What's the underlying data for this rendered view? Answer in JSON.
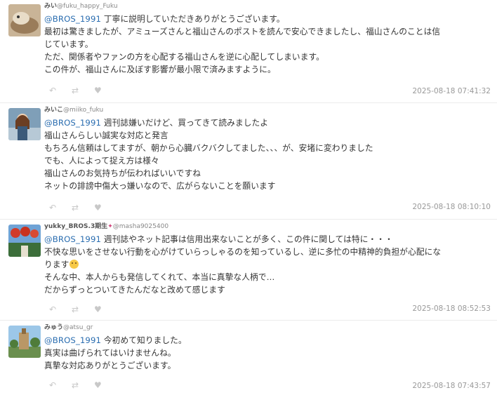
{
  "replies": [
    {
      "name": "みい",
      "handle": "@fuku_happy_Fuku",
      "mention": "",
      "lines": [
        "丁寧に説明していただきありがとうございます。",
        "最初は驚きましたが、アミューズさんと福山さんのポストを読んで安心できましたし、福山さんのことは信",
        "じています。",
        "ただ、関係者やファンの方を心配する福山さんを逆に心配してしまいます。",
        "この件が、福山さんに及ぼす影響が最小限で済みますように。"
      ],
      "first_line_mention": "@BROS_1991",
      "timestamp": "2025-08-18 07:41:32"
    },
    {
      "name": "みいこ",
      "handle": "@miiko_fuku",
      "first_line_mention": "@BROS_1991",
      "lines": [
        "週刊誌嫌いだけど、買ってきて読みましたよ",
        "福山さんらしい誠実な対応と発言",
        "もちろん信頼はしてますが、朝から心臓バクバクしてました、、、が、安堵に変わりました",
        "でも、人によって捉え方は様々",
        "福山さんのお気持ちが伝わればいいですね",
        "ネットの誹謗中傷大っ嫌いなので、広がらないことを願います"
      ],
      "timestamp": "2025-08-18 08:10:10"
    },
    {
      "name": "yukky_BROS.3期生",
      "handle": "@masha9025400",
      "first_line_mention": "@BROS_1991",
      "lines": [
        "週刊誌やネット記事は信用出来ないことが多く、この件に関しては特に・・・",
        "不快な思いをさせない行動を心がけていらっしゃるのを知っているし、逆に多忙の中精神的負担が心配にな",
        "ります",
        "そんな中、本人からも発信してくれて、本当に真摯な人柄で…",
        "だからずっとついてきたんだなと改めて感じます"
      ],
      "timestamp": "2025-08-18 08:52:53"
    },
    {
      "name": "みゅう",
      "handle": "@atsu_gr",
      "first_line_mention": "@BROS_1991",
      "lines": [
        "今初めて知りました。",
        "真実は曲げられてはいけませんね。",
        "真摯な対応ありがとうございます。"
      ],
      "timestamp": "2025-08-18 07:43:57"
    }
  ],
  "icons": {
    "reply": "reply-icon",
    "repost": "repost-icon",
    "like": "heart-icon"
  },
  "colors": {
    "mention": "#2a6db0",
    "action": "#c8c8c8",
    "timestamp": "#999999"
  }
}
